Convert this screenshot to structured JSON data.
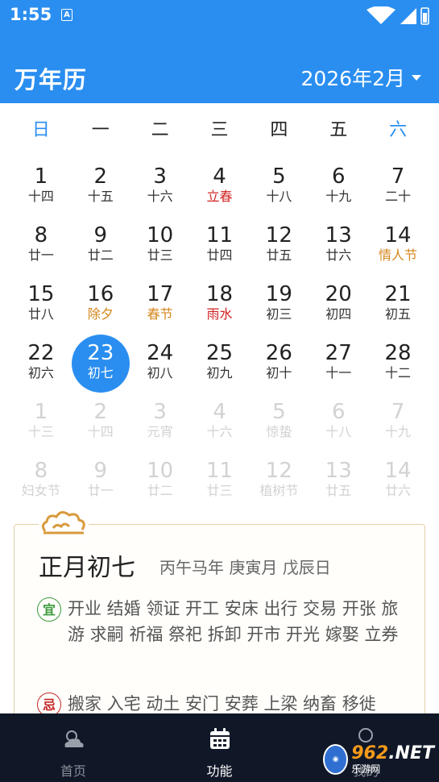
{
  "status_bar": {
    "time": "1:55",
    "notification_icon": "A"
  },
  "app_bar": {
    "title": "万年历",
    "month": "2026年2月"
  },
  "weekdays": [
    "日",
    "一",
    "二",
    "三",
    "四",
    "五",
    "六"
  ],
  "days": [
    {
      "num": "1",
      "lunar": "十四"
    },
    {
      "num": "2",
      "lunar": "十五"
    },
    {
      "num": "3",
      "lunar": "十六"
    },
    {
      "num": "4",
      "lunar": "立春"
    },
    {
      "num": "5",
      "lunar": "十八"
    },
    {
      "num": "6",
      "lunar": "十九"
    },
    {
      "num": "7",
      "lunar": "二十"
    },
    {
      "num": "8",
      "lunar": "廿一"
    },
    {
      "num": "9",
      "lunar": "廿二"
    },
    {
      "num": "10",
      "lunar": "廿三"
    },
    {
      "num": "11",
      "lunar": "廿四"
    },
    {
      "num": "12",
      "lunar": "廿五"
    },
    {
      "num": "13",
      "lunar": "廿六"
    },
    {
      "num": "14",
      "lunar": "情人节"
    },
    {
      "num": "15",
      "lunar": "廿八"
    },
    {
      "num": "16",
      "lunar": "除夕"
    },
    {
      "num": "17",
      "lunar": "春节"
    },
    {
      "num": "18",
      "lunar": "雨水"
    },
    {
      "num": "19",
      "lunar": "初三"
    },
    {
      "num": "20",
      "lunar": "初四"
    },
    {
      "num": "21",
      "lunar": "初五"
    },
    {
      "num": "22",
      "lunar": "初六"
    },
    {
      "num": "23",
      "lunar": "初七"
    },
    {
      "num": "24",
      "lunar": "初八"
    },
    {
      "num": "25",
      "lunar": "初九"
    },
    {
      "num": "26",
      "lunar": "初十"
    },
    {
      "num": "27",
      "lunar": "十一"
    },
    {
      "num": "28",
      "lunar": "十二"
    },
    {
      "num": "1",
      "lunar": "十三"
    },
    {
      "num": "2",
      "lunar": "十四"
    },
    {
      "num": "3",
      "lunar": "元宵"
    },
    {
      "num": "4",
      "lunar": "十六"
    },
    {
      "num": "5",
      "lunar": "惊蛰"
    },
    {
      "num": "6",
      "lunar": "十八"
    },
    {
      "num": "7",
      "lunar": "十九"
    },
    {
      "num": "8",
      "lunar": "妇女节"
    },
    {
      "num": "9",
      "lunar": "廿一"
    },
    {
      "num": "10",
      "lunar": "廿二"
    },
    {
      "num": "11",
      "lunar": "廿三"
    },
    {
      "num": "12",
      "lunar": "植树节"
    },
    {
      "num": "13",
      "lunar": "廿五"
    },
    {
      "num": "14",
      "lunar": "廿六"
    }
  ],
  "card": {
    "lunar_date": "正月初七",
    "ganzhi": "丙午马年 庚寅月 戊辰日",
    "yi_label": "宜",
    "yi": "开业 结婚 领证 开工 安床 出行 交易 开张 旅游 求嗣 祈福 祭祀 拆卸 开市 开光 嫁娶 立券",
    "ji_label": "忌",
    "ji": "搬家 入宅 动土 安门 安葬 上梁 纳畜 移徙"
  },
  "bottom_nav": [
    {
      "label": "首页",
      "icon": "weather-icon"
    },
    {
      "label": "功能",
      "icon": "calendar-icon"
    },
    {
      "label": "我的",
      "icon": "profile-icon"
    }
  ],
  "watermark": {
    "num": "962",
    "suffix": ".NET",
    "sub": "乐游网"
  },
  "colors": {
    "primary": "#2a8ef0",
    "festival": "#d4861c",
    "solar_term": "#d32222",
    "nav_bg": "#101727"
  }
}
